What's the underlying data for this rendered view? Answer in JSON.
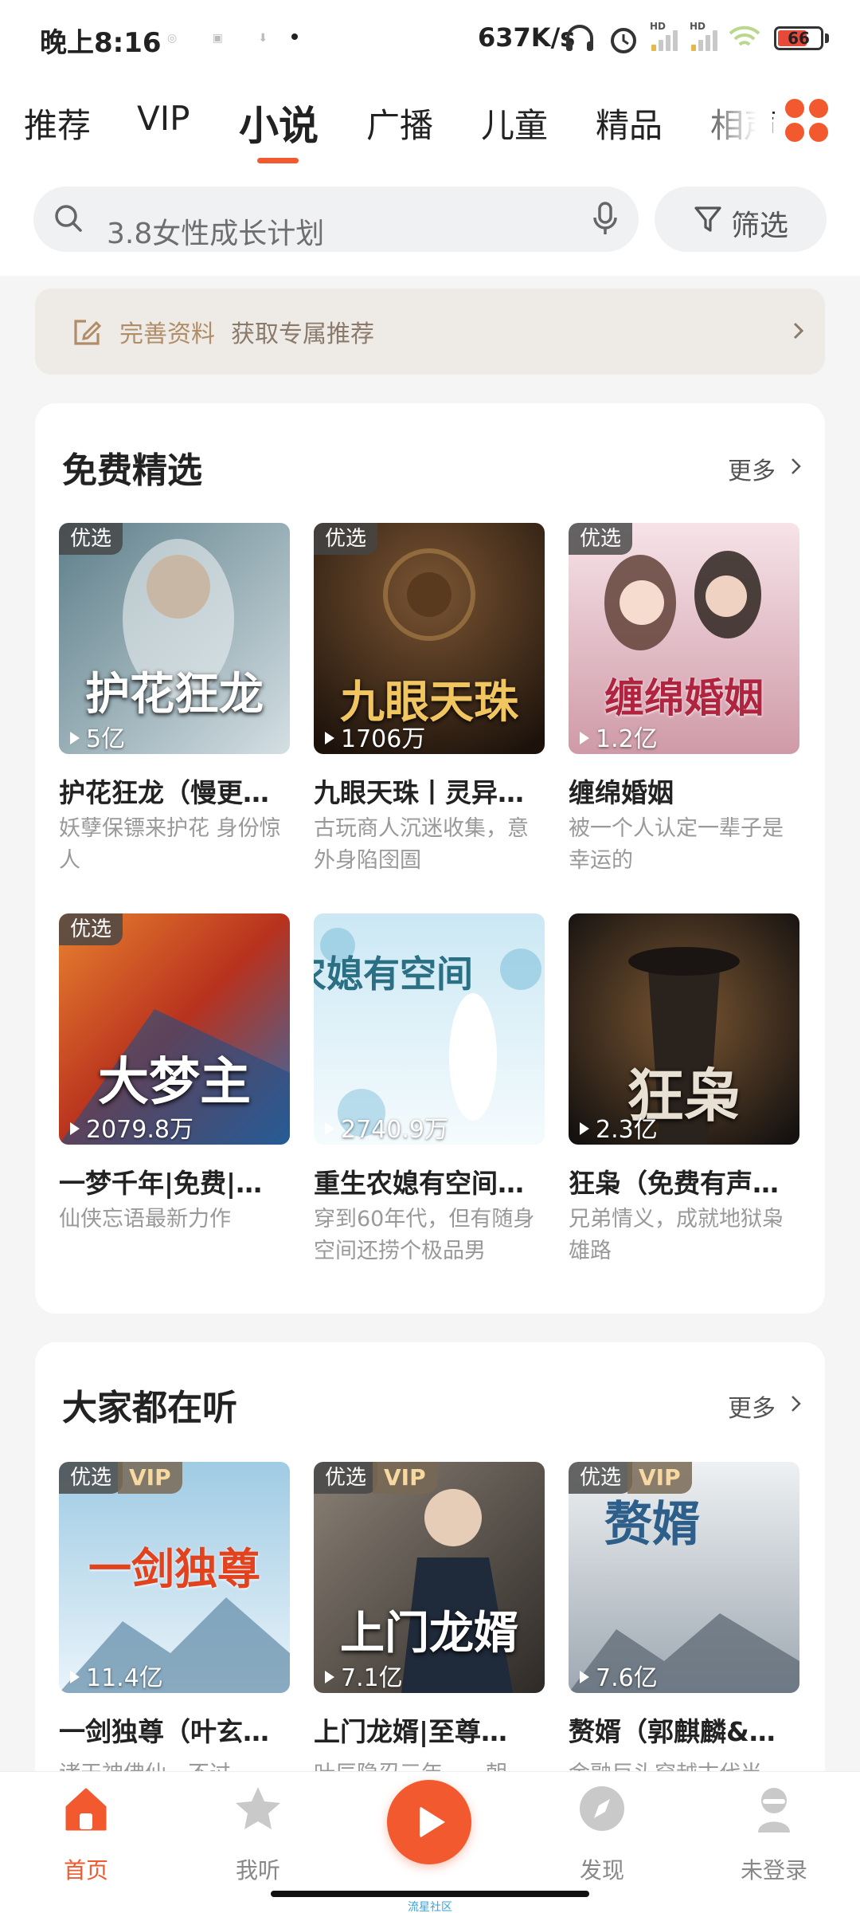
{
  "status_bar": {
    "time": "晚上8:16",
    "speed": "637K/s",
    "battery": "66",
    "hd1": "HD",
    "hd2": "HD"
  },
  "tabs": [
    {
      "label": "推荐"
    },
    {
      "label": "VIP"
    },
    {
      "label": "小说",
      "active": true
    },
    {
      "label": "广播"
    },
    {
      "label": "儿童"
    },
    {
      "label": "精品"
    },
    {
      "label": "相声"
    }
  ],
  "search": {
    "text": "3.8女性成长计划",
    "filter_label": "筛选"
  },
  "profile_banner": {
    "accent": "完善资料",
    "text": "获取专属推荐"
  },
  "sections": [
    {
      "title": "免费精选",
      "more": "更多",
      "books": [
        {
          "badge": "优选",
          "plays": "5亿",
          "title": "护花狂龙（慢更…",
          "desc": "妖孽保镖来护花 身份惊人",
          "cover_title": "护花狂龙",
          "colors": [
            "#6f8f9a",
            "#c9d6db"
          ]
        },
        {
          "badge": "优选",
          "plays": "1706万",
          "title": "九眼天珠丨灵异…",
          "desc": "古玩商人沉迷收集，意外身陷囹圄",
          "cover_title": "九眼天珠",
          "colors": [
            "#2b1d12",
            "#6e4a2a"
          ]
        },
        {
          "badge": "优选",
          "plays": "1.2亿",
          "title": "缠绵婚姻",
          "desc": "被一个人认定一辈子是幸运的",
          "cover_title": "缠绵婚姻",
          "colors": [
            "#d9a9b4",
            "#f4dde2"
          ]
        },
        {
          "badge": "优选",
          "plays": "2079.8万",
          "title": "一梦千年|免费|…",
          "desc": "仙侠忘语最新力作",
          "cover_title": "大梦主",
          "colors": [
            "#d4542a",
            "#3a78b8"
          ]
        },
        {
          "badge": "",
          "plays": "2740.9万",
          "title": "重生农媳有空间…",
          "desc": "穿到60年代，但有随身空间还捞个极品男",
          "cover_title": "农媳有空间",
          "colors": [
            "#a6d4e8",
            "#eef7fb"
          ]
        },
        {
          "badge": "",
          "plays": "2.3亿",
          "title": "狂枭（免费有声…",
          "desc": "兄弟情义，成就地狱枭雄路",
          "cover_title": "狂枭",
          "colors": [
            "#1e1a16",
            "#6b4a2c"
          ]
        }
      ]
    },
    {
      "title": "大家都在听",
      "more": "更多",
      "books": [
        {
          "badge": "优选",
          "vip": "VIP",
          "plays": "11.4亿",
          "title": "一剑独尊（叶玄…",
          "desc": "诸天神佛仙，不过一",
          "cover_title": "一剑独尊",
          "colors": [
            "#7fb6d6",
            "#e8f2f8"
          ]
        },
        {
          "badge": "优选",
          "vip": "VIP",
          "plays": "7.1亿",
          "title": "上门龙婿|至尊…",
          "desc": "叶辰隐忍三年，一朝",
          "cover_title": "上门龙婿",
          "colors": [
            "#3e3a36",
            "#9a8f84"
          ]
        },
        {
          "badge": "优选",
          "vip": "VIP",
          "plays": "7.6亿",
          "title": "赘婿（郭麒麟&…",
          "desc": "金融巨头穿越古代当",
          "cover_title": "赘婿",
          "colors": [
            "#aab4bd",
            "#eef1f3"
          ]
        }
      ]
    }
  ],
  "bottom_nav": [
    {
      "label": "首页",
      "active": true,
      "icon": "home-icon"
    },
    {
      "label": "我听",
      "icon": "star-icon"
    },
    {
      "label": "",
      "icon": "play-icon"
    },
    {
      "label": "发现",
      "icon": "compass-icon"
    },
    {
      "label": "未登录",
      "icon": "profile-icon"
    }
  ],
  "watermark": "流星社区",
  "accent_color": "#f2592e"
}
